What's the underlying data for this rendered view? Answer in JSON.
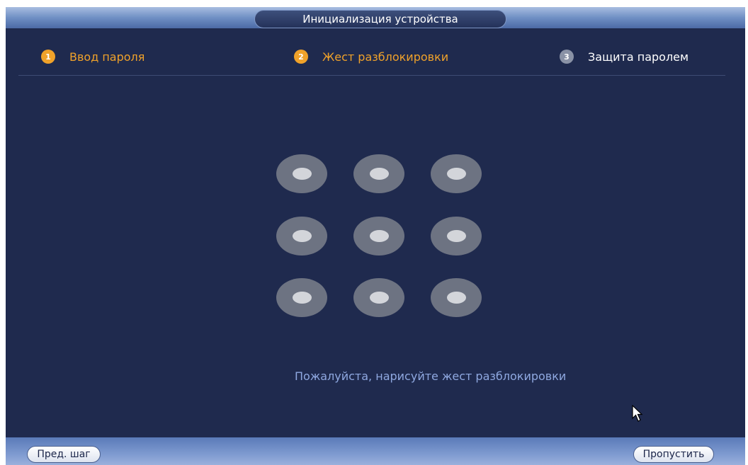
{
  "window": {
    "title": "Инициализация устройства"
  },
  "steps": [
    {
      "number": "1",
      "label": "Ввод пароля",
      "state": "active"
    },
    {
      "number": "2",
      "label": "Жест разблокировки",
      "state": "active"
    },
    {
      "number": "3",
      "label": "Защита паролем",
      "state": "inactive"
    }
  ],
  "pattern": {
    "grid_size": "3x3",
    "hint": "Пожалуйста, нарисуйте жест разблокировки"
  },
  "footer": {
    "prev_label": "Пред. шаг",
    "skip_label": "Пропустить"
  },
  "colors": {
    "background": "#1f2a4e",
    "accent": "#f0a22a",
    "hint": "#8fa8e0",
    "inactive_step": "#8a92a6"
  }
}
